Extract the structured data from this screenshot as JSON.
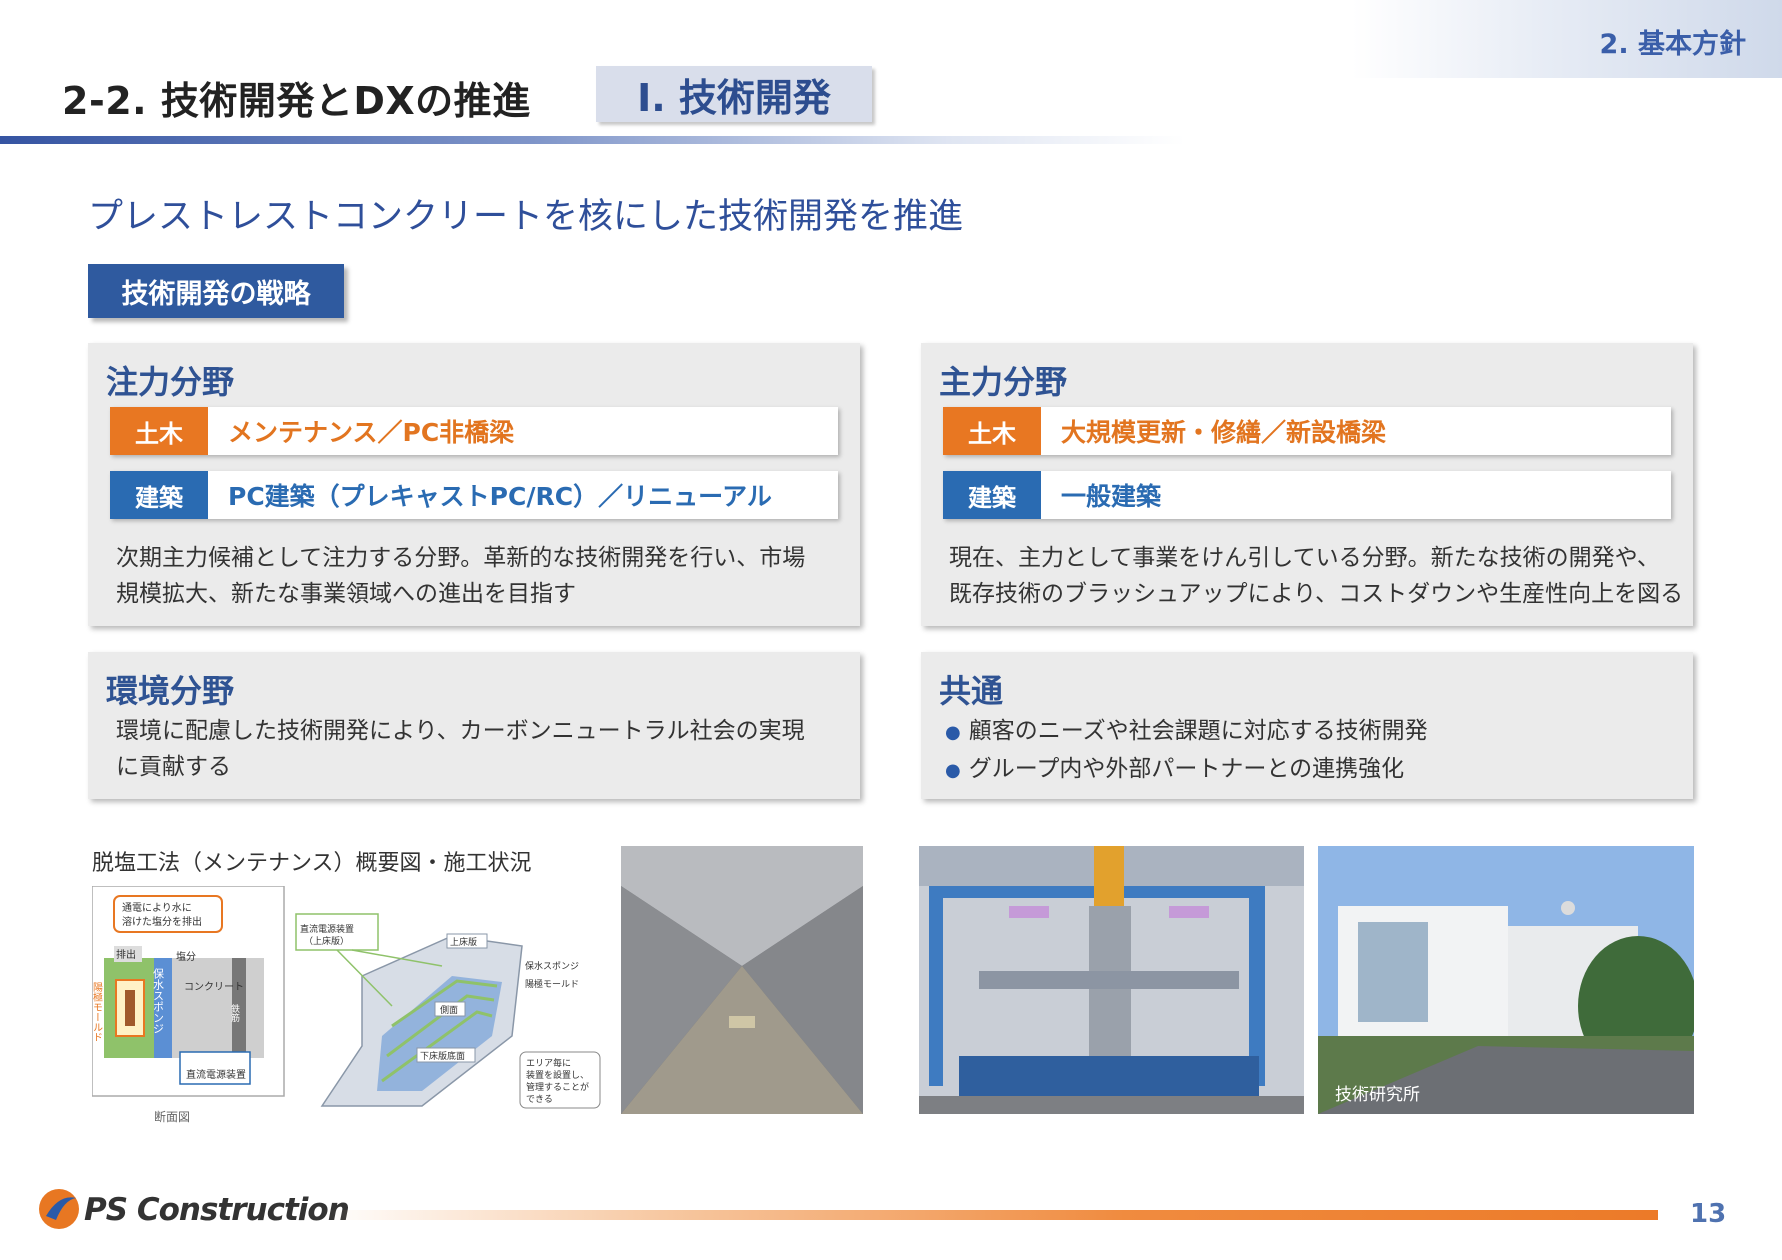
{
  "header": {
    "section_tag": "2. 基本方針",
    "title": "2-2. 技術開発とDXの推進",
    "title_tag": "Ⅰ. 技術開発"
  },
  "subtitle": "プレストレストコンクリートを核にした技術開発を推進",
  "strategy_label": "技術開発の戦略",
  "panels": {
    "focus": {
      "heading": "注力分野",
      "rows": [
        {
          "tag": "土木",
          "text": "メンテナンス／PC非橋梁"
        },
        {
          "tag": "建築",
          "text": "PC建築（プレキャストPC/RC）／リニューアル"
        }
      ],
      "description": [
        "次期主力候補として注力する分野。革新的な技術開発を行い、市場",
        "規模拡大、新たな事業領域への進出を目指す"
      ]
    },
    "main": {
      "heading": "主力分野",
      "rows": [
        {
          "tag": "土木",
          "text": "大規模更新・修繕／新設橋梁"
        },
        {
          "tag": "建築",
          "text": "一般建築"
        }
      ],
      "description": [
        "現在、主力として事業をけん引している分野。新たな技術の開発や、",
        "既存技術のブラッシュアップにより、コストダウンや生産性向上を図る"
      ]
    },
    "environment": {
      "heading": "環境分野",
      "description": [
        "環境に配慮した技術開発により、カーボンニュートラル社会の実現",
        "に貢献する"
      ]
    },
    "common": {
      "heading": "共通",
      "bullets": [
        "顧客のニーズや社会課題に対応する技術開発",
        "グループ内や外部パートナーとの連携強化"
      ]
    }
  },
  "figure": {
    "caption": "脱塩工法（メンテナンス）概要図・施工状況",
    "diagram": {
      "discharge_note": [
        "通電により水に",
        "溶けた塩分を排出"
      ],
      "discharge": "排出",
      "salt": "塩分",
      "sponge": "保水スポンジ",
      "anode_mold": "陽極モールド",
      "concrete": "コンクリート",
      "rebar": "鉄筋",
      "power_supply": "直流電源装置",
      "section_label": "断面図",
      "power_supply_top": [
        "直流電源装置",
        "（上床版）"
      ],
      "upper_slab": "上床版",
      "side_wall": "側面",
      "lower_slab": "下床版底面",
      "sponge_label": "保水スポンジ",
      "anode_label": "陽極モールド",
      "area_note": [
        "エリア毎に",
        "装置を設置し、",
        "管理することが",
        "できる"
      ]
    },
    "building_caption": "技術研究所"
  },
  "footer": {
    "logo_text": "PS Construction",
    "page_number": "13"
  },
  "colors": {
    "primary_blue": "#2f5393",
    "accent_orange": "#e87722",
    "building_blue": "#2a6bb2",
    "panel_gray": "#ebebeb"
  }
}
